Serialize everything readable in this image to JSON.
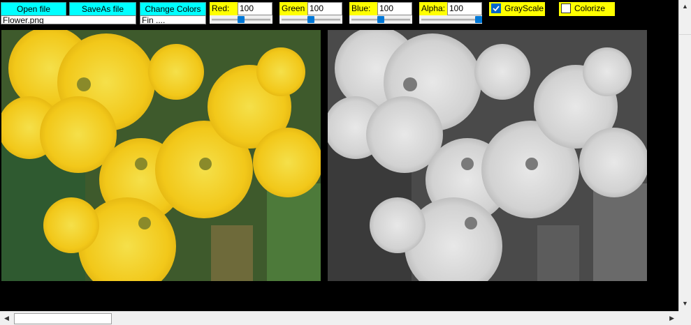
{
  "toolbar": {
    "open_label": "Open file",
    "saveas_label": "SaveAs file",
    "change_colors_label": "Change Colors"
  },
  "fields": {
    "filename": "Flower.png",
    "status": "Fin ...."
  },
  "channels": {
    "red": {
      "label": "Red:",
      "value": "100",
      "slider_level": 0.5
    },
    "green": {
      "label": "Green",
      "value": "100",
      "slider_level": 0.5
    },
    "blue": {
      "label": "Blue:",
      "value": "100",
      "slider_level": 0.5
    },
    "alpha": {
      "label": "Alpha:",
      "value": "100",
      "slider_level": 1.0
    }
  },
  "options": {
    "grayscale": {
      "label": "GrayScale",
      "checked": true
    },
    "colorize": {
      "label": "Colorize",
      "checked": false
    }
  },
  "colors": {
    "button_bg": "#00ffff",
    "label_bg": "#ffff00",
    "canvas_bg": "#000000",
    "slider_thumb": "#0078d7"
  },
  "scrollbars": {
    "horizontal_thumb_fraction": 0.15
  }
}
